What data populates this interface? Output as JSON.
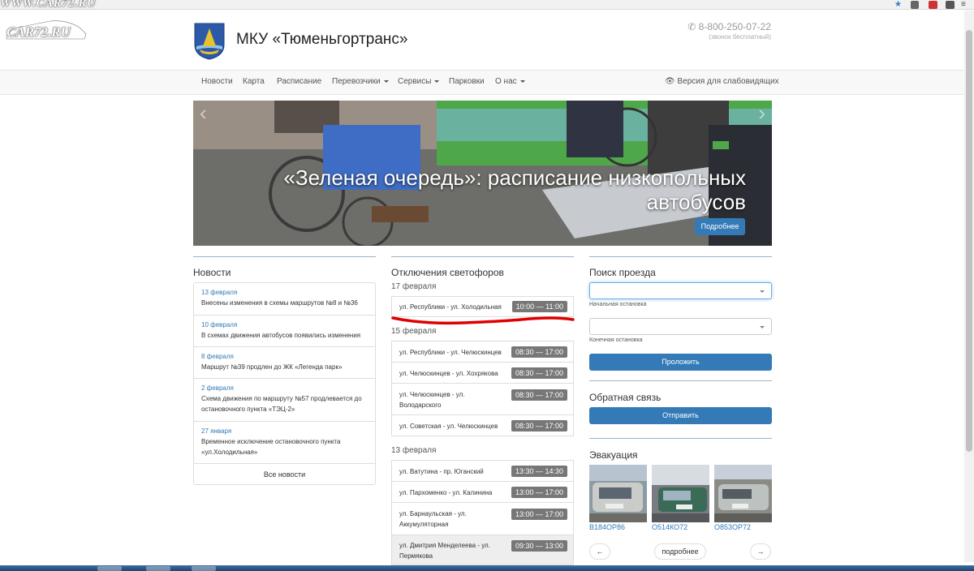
{
  "watermark": {
    "top": "WWW.CAR72.RU",
    "logo": "CAR72.RU"
  },
  "header": {
    "title": "МКУ «Тюменьгортранс»",
    "phone": "8-800-250-07-22",
    "phone_note": "(звонок бесплатный)"
  },
  "nav": {
    "items": [
      "Новости",
      "Карта",
      "Расписание",
      "Перевозчики",
      "Сервисы",
      "Парковки",
      "О нас"
    ],
    "accessibility": "Версия для слабовидящих"
  },
  "hero": {
    "caption": "«Зеленая очередь»: расписание низкопольных автобусов",
    "more": "Подробнее"
  },
  "news": {
    "title": "Новости",
    "items": [
      {
        "date": "13 февраля",
        "text": "Внесены изменения в схемы маршрутов №8 и №36"
      },
      {
        "date": "10 февраля",
        "text": "В схемах движения автобусов появились изменения"
      },
      {
        "date": "8 февраля",
        "text": "Маршрут №39 продлен до ЖК «Легенда парк»"
      },
      {
        "date": "2 февраля",
        "text": "Схема движения по маршруту №57 продлевается до остановочного пункта «ТЭЦ-2»"
      },
      {
        "date": "27 января",
        "text": "Временное исключение остановочного пункта «ул.Холодильная»"
      }
    ],
    "all": "Все новости"
  },
  "outages": {
    "title": "Отключения светофоров",
    "groups": [
      {
        "date": "17 февраля",
        "rows": [
          {
            "street": "ул. Республики - ул. Холодильная",
            "time": "10:00 — 11:00"
          }
        ]
      },
      {
        "date": "15 февраля",
        "rows": [
          {
            "street": "ул. Республики - ул. Челюскинцев",
            "time": "08:30 — 17:00"
          },
          {
            "street": "ул. Челюскинцев - ул. Хохрякова",
            "time": "08:30 — 17:00"
          },
          {
            "street": "ул. Челюскинцев - ул. Володарского",
            "time": "08:30 — 17:00"
          },
          {
            "street": "ул. Советская - ул. Челюскинцев",
            "time": "08:30 — 17:00"
          }
        ]
      },
      {
        "date": "13 февраля",
        "rows": [
          {
            "street": "ул. Ватутина - пр. Юганский",
            "time": "13:30 — 14:30"
          },
          {
            "street": "ул. Пархоменко - ул. Калинина",
            "time": "13:00 — 17:00"
          },
          {
            "street": "ул. Барнаульская - ул. Аккумуляторная",
            "time": "13:00 — 17:00"
          },
          {
            "street": "ул. Дмитрия Менделеева - ул. Пермякова",
            "time": "09:30 — 13:00"
          }
        ]
      }
    ]
  },
  "search": {
    "title": "Поиск проезда",
    "start_label": "Начальная остановка",
    "end_label": "Конечная остановка",
    "button": "Проложить"
  },
  "feedback": {
    "title": "Обратная связь",
    "button": "Отправить"
  },
  "evacuation": {
    "title": "Эвакуация",
    "plates": [
      "В184ОР86",
      "О514КО72",
      "О853ОР72"
    ],
    "prev": "←",
    "more": "подробнее",
    "next": "→"
  },
  "colors": {
    "primary": "#337ab7",
    "badge": "#777777",
    "annotation": "#e00000"
  }
}
